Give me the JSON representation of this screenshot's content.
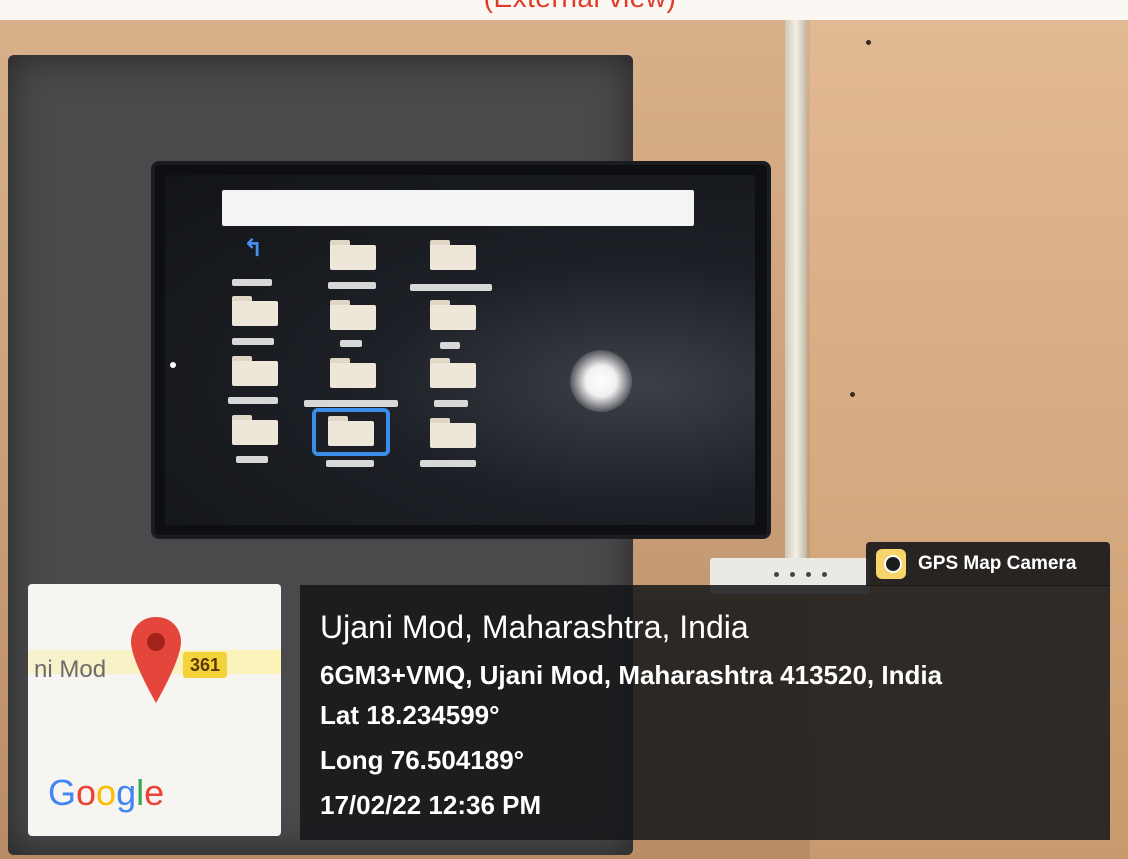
{
  "top_caption": "(External view)",
  "badge": {
    "label": "GPS Map Camera",
    "icon": "camera-pin-icon"
  },
  "location": {
    "title": "Ujani Mod, Maharashtra, India",
    "address": "6GM3+VMQ, Ujani Mod, Maharashtra 413520, India",
    "lat": "Lat 18.234599°",
    "long": "Long 76.504189°",
    "datetime": "17/02/22 12:36 PM"
  },
  "map": {
    "place_label": "ni Mod",
    "route_number": "361",
    "brand": "Google",
    "pin_icon": "map-pin-icon"
  },
  "colors": {
    "caption_red": "#e03b2a",
    "selection_blue": "#3b8ee8",
    "pin_red": "#e5463b",
    "route_yellow": "#f4d23a"
  }
}
